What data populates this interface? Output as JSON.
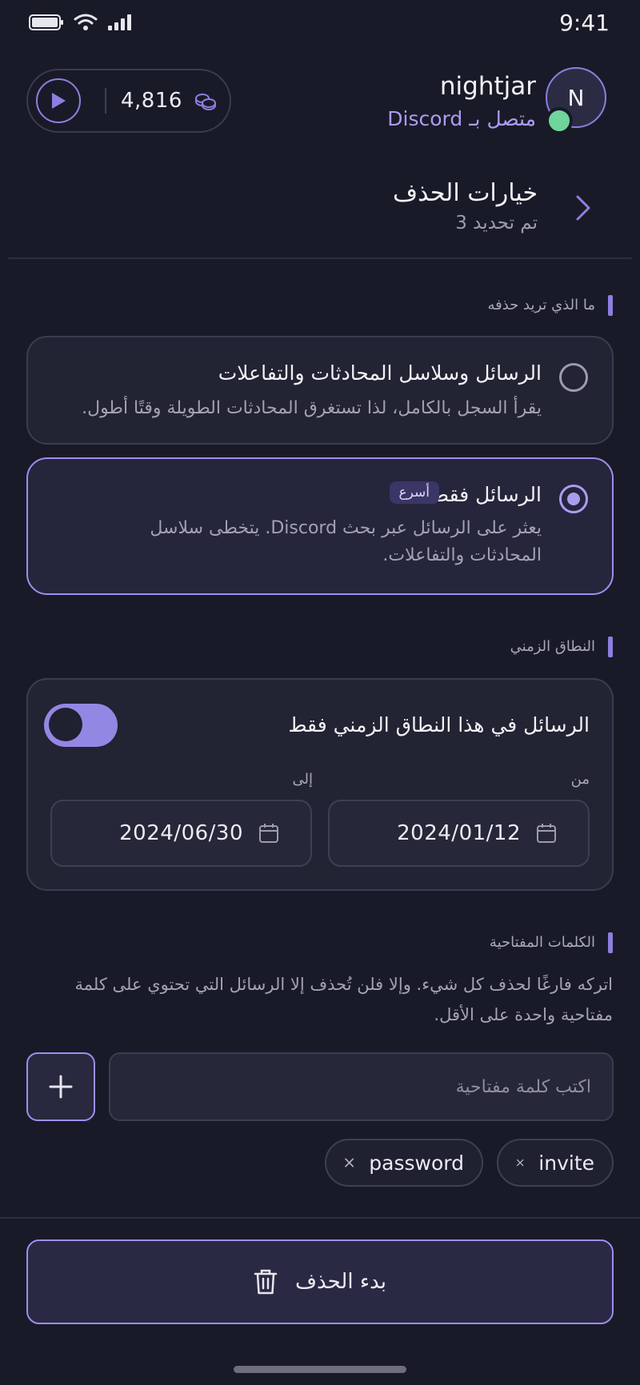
{
  "status_bar": {
    "time": "9:41"
  },
  "header": {
    "credits": "4,816",
    "username": "nightjar",
    "connected_label": "متصل بـ Discord",
    "avatar_initial": "N"
  },
  "delete_options": {
    "title": "خيارات الحذف",
    "subtitle": "تم تحديد 3"
  },
  "what_to_delete": {
    "section_label": "ما الذي تريد حذفه",
    "options": [
      {
        "title": "الرسائل وسلاسل المحادثات والتفاعلات",
        "description": "يقرأ السجل بالكامل، لذا تستغرق المحادثات الطويلة وقتًا أطول.",
        "selected": false
      },
      {
        "title": "الرسائل فقط",
        "badge": "أسرع",
        "description": "يعثر على الرسائل عبر بحث Discord. يتخطى سلاسل المحادثات والتفاعلات.",
        "selected": true
      }
    ]
  },
  "time_range": {
    "section_label": "النطاق الزمني",
    "toggle_label": "الرسائل في هذا النطاق الزمني فقط",
    "toggle_on": true,
    "from_label": "من",
    "from_value": "2024/01/12",
    "to_label": "إلى",
    "to_value": "2024/06/30"
  },
  "keywords": {
    "section_label": "الكلمات المفتاحية",
    "help": "اتركه فارغًا لحذف كل شيء. وإلا فلن تُحذف إلا الرسائل التي تحتوي على كلمة مفتاحية واحدة على الأقل.",
    "placeholder": "اكتب كلمة مفتاحية",
    "chips": [
      "invite",
      "password"
    ]
  },
  "start_button": {
    "label": "بدء الحذف"
  },
  "colors": {
    "accent": "#9c8fee",
    "background": "#191a28",
    "online": "#6fd59a"
  }
}
